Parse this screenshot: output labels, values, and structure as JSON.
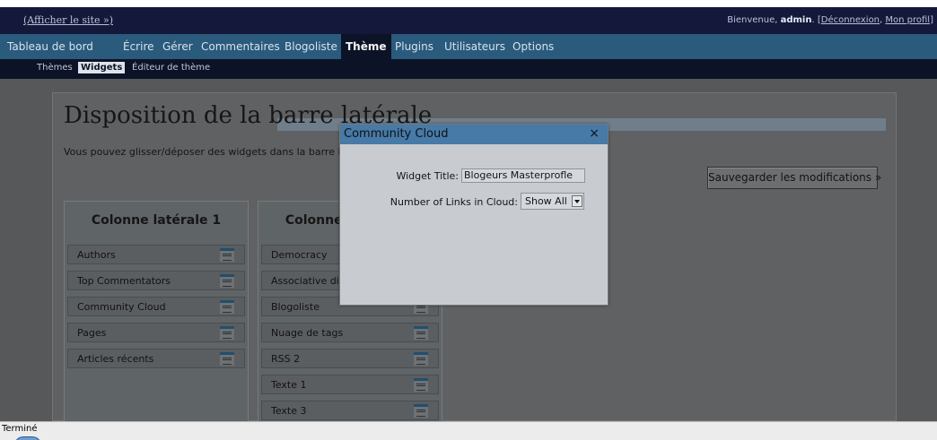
{
  "topbar": {
    "site_link": "(Afficher le site »)",
    "welcome_prefix": "Bienvenue, ",
    "username": "admin",
    "welcome_mid": ". [",
    "logout": "Déconnexion",
    "separator": ", ",
    "profile": "Mon profil",
    "welcome_end": "]"
  },
  "menu": {
    "dashboard": "Tableau de bord",
    "write": "Écrire",
    "manage": "Gérer",
    "comments": "Commentaires",
    "blogroll": "Blogoliste",
    "theme": "Thème",
    "plugins": "Plugins",
    "users": "Utilisateurs",
    "options": "Options"
  },
  "submenu": {
    "themes": "Thèmes",
    "widgets": "Widgets",
    "theme_editor": "Éditeur de thème"
  },
  "page": {
    "title": "Disposition de la barre latérale",
    "intro": "Vous pouvez glisser/déposer des widgets dans la barre latérale.",
    "save_button": "Sauvegarder les modifications »"
  },
  "sidebar1": {
    "heading": "Colonne latérale 1",
    "widgets": [
      "Authors",
      "Top Commentators",
      "Community Cloud",
      "Pages",
      "Articles récents"
    ]
  },
  "sidebar2": {
    "heading": "Colonne latérale 2",
    "widgets": [
      "Democracy",
      "Associative dictionary",
      "Blogoliste",
      "Nuage de tags",
      "RSS 2",
      "Texte 1",
      "Texte 3"
    ]
  },
  "modal": {
    "title": "Community Cloud",
    "close": "×",
    "widget_title_label": "Widget Title:",
    "widget_title_value": "Blogeurs Masterprofle",
    "links_label": "Number of Links in Cloud:",
    "links_value": "Show All"
  },
  "status": {
    "text": "Terminé"
  },
  "colors": {
    "topbar": "#14183a",
    "menubar": "#2a5a7c",
    "submenu": "#0d1326",
    "overlay": "#56585a",
    "modal_header": "#477aa6",
    "modal_body": "#c8ccd0"
  }
}
